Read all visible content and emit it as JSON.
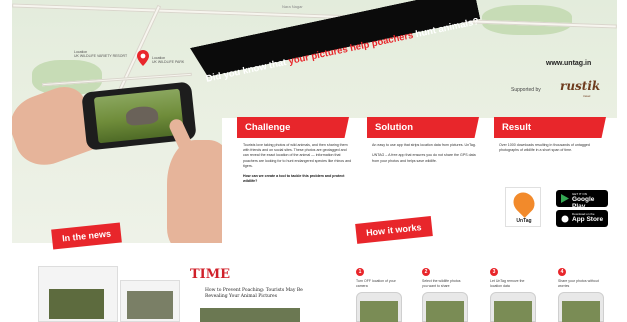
{
  "banner": {
    "prefix": "Did you know that ",
    "highlight": "your pictures help poachers",
    "suffix": " hunt animals?"
  },
  "url": "www.untag.in",
  "sponsor": {
    "label": "Supported by",
    "name": "rustik",
    "sub": "travel"
  },
  "map": {
    "road_top": "Nara Nagar",
    "pin_left_label": "Location\nUK WILDLIFE VARIETY RESORT",
    "pin_right_label": "Location\nUK WILDLIFE PARK"
  },
  "sections": [
    {
      "title": "Challenge",
      "body": "Tourists love taking photos of wild animals, and then sharing them with friends and on social sites. These photos are geotagged and can reveal the exact location of the animal — information that poachers are looking for to hunt endangered species like rhinos and tigers.",
      "question": "How can we create a tool to tackle this problem and protect wildlife?"
    },
    {
      "title": "Solution",
      "body": "An easy to use app that strips location data from pictures. UnTag.",
      "extra": "UNTAG – A free app that ensures you do not share the GPS data from your photos and helps save wildlife."
    },
    {
      "title": "Result",
      "body": "Over 1000 downloads resulting in thousands of untagged photographs of wildlife in a short span of time."
    }
  ],
  "app": {
    "name": "UnTag"
  },
  "stores": [
    {
      "small": "GET IT ON",
      "big": "Google Play"
    },
    {
      "small": "Download on the",
      "big": "App Store"
    }
  ],
  "tags": {
    "news": "In the news",
    "how": "How it works"
  },
  "press": {
    "logo": "TIME",
    "headline": "How to Prevent Poaching: Tourists May Be Revealing Your Animal Pictures"
  },
  "steps": [
    {
      "num": "1",
      "text": "Turn OFF location of your camera"
    },
    {
      "num": "2",
      "text": "Select the wildlife photos you want to share"
    },
    {
      "num": "3",
      "text": "Let UnTag remove the location data"
    },
    {
      "num": "4",
      "text": "Share your photos without worries"
    }
  ],
  "colors": {
    "accent": "#e8262b",
    "banner": "#0b0b0b",
    "app": "#f28a2b"
  }
}
